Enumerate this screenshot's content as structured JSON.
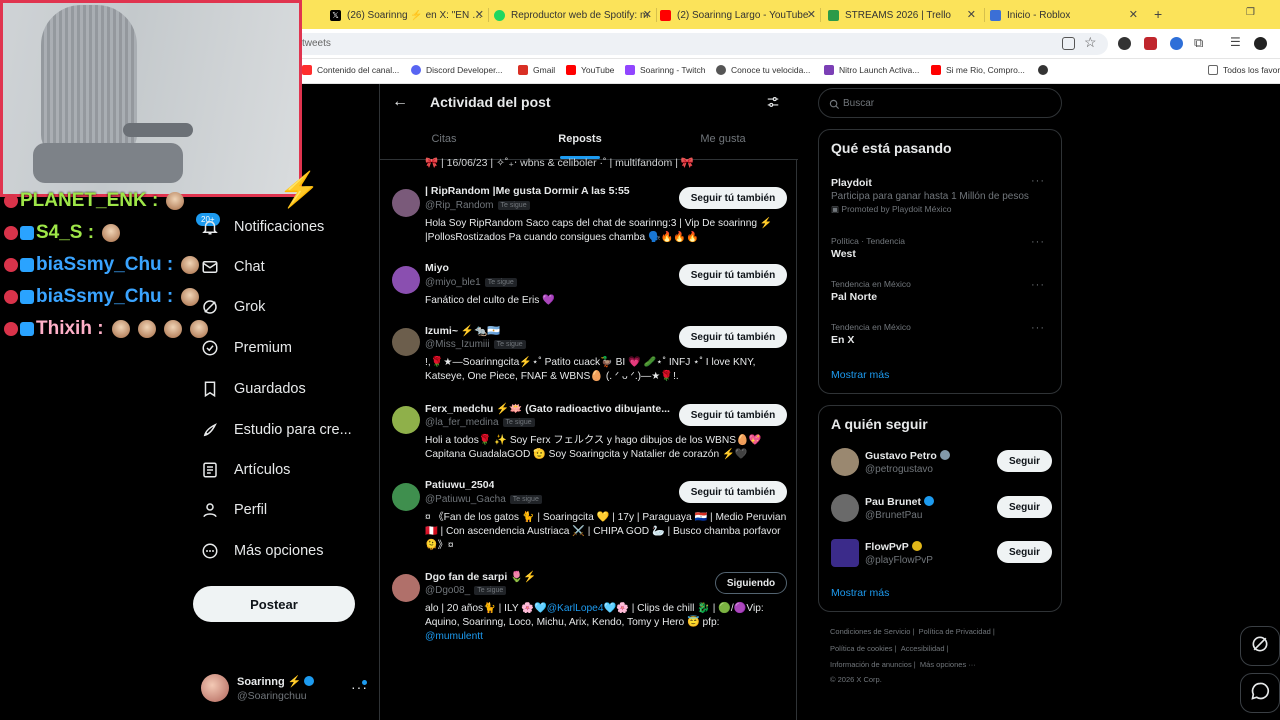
{
  "browser": {
    "tabs": [
      {
        "title": "(26) Soarinng ⚡ en X: \"EN STR",
        "color": "#000000"
      },
      {
        "title": "Reproductor web de Spotify: m",
        "color": "#1ed760"
      },
      {
        "title": "(2) Soarinng Largo - YouTube",
        "color": "#ff0000"
      },
      {
        "title": "STREAMS 2026 | Trello",
        "color": "#2b9a48"
      },
      {
        "title": "Inicio - Roblox",
        "color": "#3b6fd6"
      }
    ],
    "url_fragment": "tweets",
    "bookmarks": [
      {
        "label": "Contenido del canal...",
        "color": "#ff2d2d"
      },
      {
        "label": "Discord Developer...",
        "color": "#5865f2"
      },
      {
        "label": "Gmail",
        "color": "#d93025"
      },
      {
        "label": "YouTube",
        "color": "#ff0000"
      },
      {
        "label": "Soarinng - Twitch",
        "color": "#9146ff"
      },
      {
        "label": "Conoce tu velocida...",
        "color": "#555555"
      },
      {
        "label": "Nitro Launch Activa...",
        "color": "#7b3fb5"
      },
      {
        "label": "Si me Rio, Compro...",
        "color": "#ff0000"
      },
      {
        "label": "Todos los favor",
        "color": "#555555"
      }
    ]
  },
  "stream_chat": {
    "lines": [
      {
        "name": "PLANET_ENK :",
        "color": "#9ee648"
      },
      {
        "name": "S4_S :",
        "color": "#9ee648"
      },
      {
        "name": "biaSsmy_Chu :",
        "color": "#3aa4ff"
      },
      {
        "name": "biaSsmy_Chu :",
        "color": "#3aa4ff"
      },
      {
        "name": "Thixih :",
        "color": "#ffb0c8"
      }
    ]
  },
  "sidebar": {
    "badge": "20+",
    "items": [
      {
        "label": "Notificaciones",
        "icon": "bell-icon"
      },
      {
        "label": "Chat",
        "icon": "mail-icon"
      },
      {
        "label": "Grok",
        "icon": "grok-icon"
      },
      {
        "label": "Premium",
        "icon": "premium-icon"
      },
      {
        "label": "Guardados",
        "icon": "bookmark-icon"
      },
      {
        "label": "Estudio para cre...",
        "icon": "rocket-icon"
      },
      {
        "label": "Artículos",
        "icon": "article-icon"
      },
      {
        "label": "Perfil",
        "icon": "person-icon"
      },
      {
        "label": "Más opciones",
        "icon": "more-circle-icon"
      }
    ],
    "post_button": "Postear",
    "account": {
      "name": "Soarinng ⚡",
      "handle": "@Soaringchuu"
    }
  },
  "main": {
    "title": "Actividad del post",
    "tabs": [
      "Citas",
      "Reposts",
      "Me gusta"
    ],
    "active_tab": "Reposts",
    "previous_line": "🎀 | 16/06/23 | ✧˚₊‧ wbns & celiboler ·˚ | multifandom | 🎀",
    "follows_you_label": "Te sigue",
    "users": [
      {
        "name": "| RipRandom |Me gusta Dormir A las 5:55",
        "handle": "@Rip_Random",
        "bio": "Hola Soy RipRandom Saco caps del chat de soarinng:3 | Vip De soarinng ⚡ |PollosRostizados Pa cuando consigues chamba 🗣️🔥🔥🔥",
        "button": "Seguir tú también",
        "avatar": "#7a5a7a"
      },
      {
        "name": "Miyo",
        "handle": "@miyo_ble1",
        "bio": "Fanático del culto de Eris 💜",
        "button": "Seguir tú también",
        "avatar": "#8a4fb0"
      },
      {
        "name": "Izumi~ ⚡🐀🇦🇷",
        "handle": "@Miss_Izumiii",
        "bio": "!,🌹★—Soarinngcita⚡⋆˚ Patito cuack🦆 BI 💗 🥒⋆˚ INFJ ⋆˚ I love KNY, Katseye, One Piece, FNAF & WBNS🥚 (. ᐟ ᴗ ᐟ.)—★🌹!.",
        "button": "Seguir tú también",
        "avatar": "#6c5e4c"
      },
      {
        "name": "Ferx_medchu ⚡🪷 (Gato radioactivo dibujante...",
        "handle": "@la_fer_medina",
        "bio": "Holi a todos🌹 ✨ Soy Ferx フェルクス y hago dibujos de los WBNS🥚💖 Capitana GuadalaGOD 🫡 Soy Soaringcita y Natalier de corazón ⚡🖤",
        "button": "Seguir tú también",
        "avatar": "#8fb04a"
      },
      {
        "name": "Patiuwu_2504",
        "handle": "@Patiuwu_Gacha",
        "bio": "¤ 《Fan de los gatos 🐈 | Soaringcita 💛 | 17y | Paraguaya 🇵🇾 | Medio Peruvian 🇵🇪 | Con ascendencia Austriaca ⚔️ | CHIPA GOD 🦢 | Busco chamba porfavor 🫠》¤",
        "button": "Seguir tú también",
        "avatar": "#3f8f4e"
      },
      {
        "name": "Dgo fan de sarpi 🌷⚡",
        "handle": "@Dgo08_",
        "bio_before": "alo | 20 años🐈 | ILY 🌸🩵",
        "bio_mention": "@KarlLope4",
        "bio_after": "🩵🌸 | Clips de chill 🐉 | 🟢/🟣Vip: Aquino, Soarinng, Loco, Michu, Arix, Kendo, Tomy y Hero 😇 pfp:",
        "bio_mention2": "@mumulentt",
        "button": "Siguiendo",
        "avatar": "#b0706a"
      }
    ]
  },
  "right": {
    "search_placeholder": "Buscar",
    "trends_title": "Qué está pasando",
    "trends": [
      {
        "context": "",
        "name": "Playdoit",
        "desc": "Participa para ganar hasta 1 Millón de pesos",
        "promo": "Promoted by Playdoit México"
      },
      {
        "context": "Política · Tendencia",
        "name": "West"
      },
      {
        "context": "Tendencia en México",
        "name": "Pal Norte"
      },
      {
        "context": "Tendencia en México",
        "name": "En X"
      }
    ],
    "show_more": "Mostrar más",
    "who_title": "A quién seguir",
    "who": [
      {
        "name": "Gustavo Petro",
        "handle": "@petrogustavo",
        "button": "Seguir",
        "badge_color": "#829aab",
        "avatar": "#9a8870"
      },
      {
        "name": "Pau Brunet",
        "handle": "@BrunetPau",
        "button": "Seguir",
        "badge_color": "#1d9bf0",
        "avatar": "#6a6a6a"
      },
      {
        "name": "FlowPvP",
        "handle": "@playFlowPvP",
        "button": "Seguir",
        "badge_color": "#e2b719",
        "avatar": "#3b2b8a"
      }
    ],
    "footer": {
      "line1": [
        "Condiciones de Servicio",
        "Política de Privacidad"
      ],
      "line2": [
        "Política de cookies",
        "Accesibilidad"
      ],
      "line3": [
        "Información de anuncios",
        "Más opciones ···"
      ],
      "copyright": "© 2026 X Corp."
    }
  }
}
